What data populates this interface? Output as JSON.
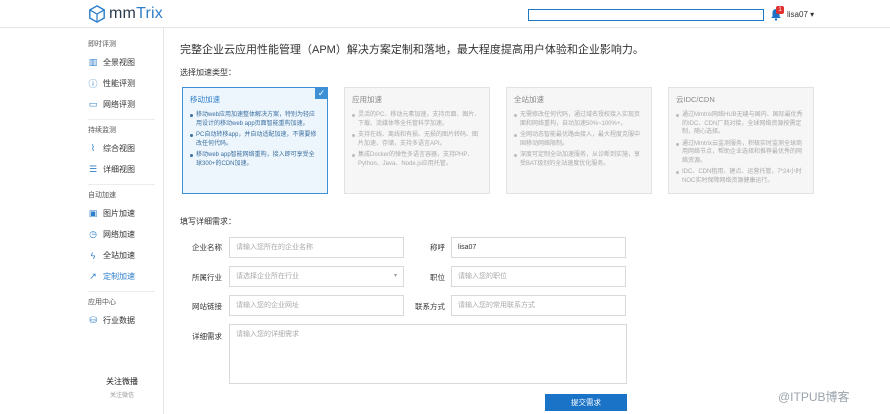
{
  "header": {
    "logo_text_prefix": "mm",
    "logo_text_suffix": "Trix",
    "search_value": "",
    "notification_count": "1",
    "user_name": "lisa07 ▾"
  },
  "sidebar": {
    "groups": [
      {
        "title": "即时评测",
        "items": [
          {
            "label": "全景视图",
            "icon": "bar-chart-icon"
          },
          {
            "label": "性能评测",
            "icon": "info-icon"
          },
          {
            "label": "网络评测",
            "icon": "monitor-icon"
          }
        ]
      },
      {
        "title": "持续监测",
        "items": [
          {
            "label": "综合视图",
            "icon": "line-chart-icon"
          },
          {
            "label": "详细视图",
            "icon": "list-icon"
          }
        ]
      },
      {
        "title": "自动加速",
        "items": [
          {
            "label": "图片加速",
            "icon": "image-icon"
          },
          {
            "label": "网络加速",
            "icon": "clock-icon"
          },
          {
            "label": "全站加速",
            "icon": "lightning-icon"
          },
          {
            "label": "定制加速",
            "icon": "diagonal-arrow-icon"
          }
        ]
      },
      {
        "title": "应用中心",
        "items": [
          {
            "label": "行业数据",
            "icon": "database-icon"
          }
        ]
      }
    ],
    "follow_title": "关注微播",
    "follow_sub": "关注微信"
  },
  "main": {
    "headline": "完整企业云应用性能管理（APM）解决方案定制和落地，最大程度提高用户体验和企业影响力。",
    "choose_label": "选择加速类型：",
    "cards": [
      {
        "title": "移动加速",
        "items": [
          "移动web应用加速整体解决方案，特别为轻应用设计的移动web app页面智能重构加速。",
          "PC自动转移app，并自动适配加速，不需要修改任何代码。",
          "移动web app智能网络重构，接入即可享受全球300+的CDN加速。"
        ]
      },
      {
        "title": "应用加速",
        "items": [
          "灵活的PC、移动元素加速，支持页面、图片、下载、流媒体等全托管科学加速。",
          "支持在线、离线和有损、无损的图片转码、图片加速、存储，支持多语言API。",
          "集成Docker的弹性多语言容器，支持PHP、Python、Java、Node.js应用托管。"
        ]
      },
      {
        "title": "全站加速",
        "items": [
          "无需修改任何代码，通过域名授权接入实现页面和网络重构，自动加速50%~100%+。",
          "全网动态智能最优路由接入，最大程度克服中国移动网络限制。",
          "深度可定制全站加速服务，从诊断到实施，享受BAT级别的全站速度优化服务。"
        ]
      },
      {
        "title": "云IDC/CDN",
        "items": [
          "通过Mmtrix网络HUB无缝与国内、国际最优秀的IDC、CDN厂商对接，全球网络资源按需定制，随心选择。",
          "通过Mmtrix云监测服务，积极实时监测全球商用网络节点，帮助企业选择和推荐最优秀的网络资源。",
          "IDC、CDN租用、建点、运营托管，7*24小时NOC实时保障网络资源健康运行。"
        ]
      }
    ],
    "form_label": "填写详细需求：",
    "fields": {
      "company_label": "企业名称",
      "company_placeholder": "请输入您所在的企业名称",
      "nick_label": "称呼",
      "nick_value": "lisa07",
      "industry_label": "所属行业",
      "industry_placeholder": "请选择企业所在行业",
      "position_label": "职位",
      "position_placeholder": "请输入您的职位",
      "website_label": "网站链接",
      "website_placeholder": "请输入您的企业网址",
      "contact_label": "联系方式",
      "contact_placeholder": "请输入您的常用联系方式",
      "detail_label": "详细需求",
      "detail_placeholder": "请输入您的详细需求"
    },
    "submit_label": "提交需求"
  },
  "watermark": "@ITPUB博客",
  "colors": {
    "accent": "#1a73c6",
    "selected_bg": "#eef6fd"
  }
}
